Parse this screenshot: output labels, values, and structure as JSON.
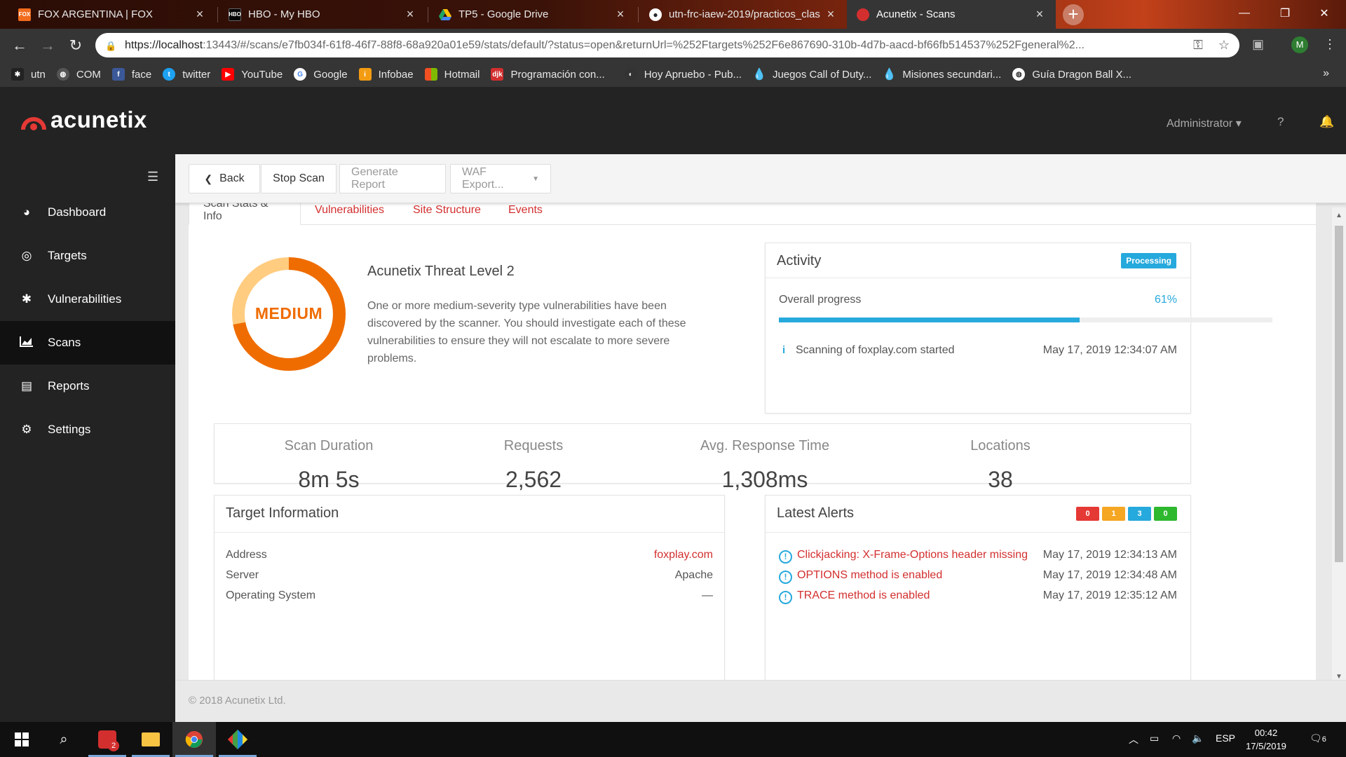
{
  "browser": {
    "tabs": [
      {
        "title": "FOX ARGENTINA | FOX",
        "favicon": "fox-icon",
        "color": "#f26b1d",
        "active": false
      },
      {
        "title": "HBO - My HBO",
        "favicon": "hbo-icon",
        "color": "#000000",
        "active": false
      },
      {
        "title": "TP5 - Google Drive",
        "favicon": "google-drive-icon",
        "color": "#1fa463",
        "active": false
      },
      {
        "title": "utn-frc-iaew-2019/practicos_clas",
        "favicon": "github-icon",
        "color": "#24292e",
        "active": false
      },
      {
        "title": "Acunetix - Scans",
        "favicon": "acunetix-icon",
        "color": "#d32f2f",
        "active": true
      }
    ],
    "url": {
      "host": "https://localhost",
      "rest": ":13443/#/scans/e7fb034f-61f8-46f7-88f8-68a920a01e59/stats/default/?status=open&returnUrl=%252Ftargets%252F6e867690-310b-4d7b-aacd-bf66fb514537%252Fgeneral%2..."
    },
    "profile_initial": "M",
    "bookmarks": [
      {
        "label": "utn",
        "icon": "utn-icon",
        "color": "#222222"
      },
      {
        "label": "COM",
        "icon": "globe-icon",
        "color": "#555555"
      },
      {
        "label": "face",
        "icon": "facebook-icon",
        "color": "#3b5998"
      },
      {
        "label": "twitter",
        "icon": "twitter-icon",
        "color": "#1da1f2"
      },
      {
        "label": "YouTube",
        "icon": "youtube-icon",
        "color": "#ff0000"
      },
      {
        "label": "Google",
        "icon": "google-icon",
        "color": "#4285f4"
      },
      {
        "label": "Infobae",
        "icon": "infobae-icon",
        "color": "#f39c12"
      },
      {
        "label": "Hotmail",
        "icon": "windows-icon",
        "color": "#f25022"
      },
      {
        "label": "Programación con...",
        "icon": "djk-icon",
        "color": "#d32f2f"
      },
      {
        "label": "Hoy Apruebo - Pub...",
        "icon": "site-icon",
        "color": "#444444"
      },
      {
        "label": "Juegos Call of Duty...",
        "icon": "drop-icon",
        "color": "#1e88e5"
      },
      {
        "label": "Misiones secundari...",
        "icon": "drop-icon",
        "color": "#1e88e5"
      },
      {
        "label": "Guía Dragon Ball X...",
        "icon": "globe-icon",
        "color": "#555555"
      }
    ]
  },
  "app": {
    "brand": "acunetix",
    "user": "Administrator",
    "nav": [
      {
        "label": "Dashboard",
        "icon": "dashboard-icon",
        "active": false
      },
      {
        "label": "Targets",
        "icon": "target-icon",
        "active": false
      },
      {
        "label": "Vulnerabilities",
        "icon": "bug-icon",
        "active": false
      },
      {
        "label": "Scans",
        "icon": "chart-icon",
        "active": true
      },
      {
        "label": "Reports",
        "icon": "report-icon",
        "active": false
      },
      {
        "label": "Settings",
        "icon": "gear-icon",
        "active": false
      }
    ],
    "actions": {
      "back": "Back",
      "stop_scan": "Stop Scan",
      "generate_report": "Generate Report",
      "waf_export": "WAF Export..."
    },
    "tabs": [
      "Scan Stats & Info",
      "Vulnerabilities",
      "Site Structure",
      "Events"
    ],
    "threat": {
      "title": "Acunetix Threat Level 2",
      "level_label": "MEDIUM",
      "level": 2,
      "description": "One or more medium-severity type vulnerabilities have been discovered by the scanner. You should investigate each of these vulnerabilities to ensure they will not escalate to more severe problems."
    },
    "activity": {
      "title": "Activity",
      "status": "Processing",
      "progress_label": "Overall progress",
      "progress_text": "61%",
      "progress": 61,
      "events": [
        {
          "text": "Scanning of foxplay.com started",
          "time": "May 17, 2019 12:34:07 AM"
        }
      ]
    },
    "stats": [
      {
        "label": "Scan Duration",
        "value": "8m 5s"
      },
      {
        "label": "Requests",
        "value": "2,562"
      },
      {
        "label": "Avg. Response Time",
        "value": "1,308ms"
      },
      {
        "label": "Locations",
        "value": "38"
      }
    ],
    "target_info": {
      "title": "Target Information",
      "rows": [
        {
          "label": "Address",
          "value": "foxplay.com"
        },
        {
          "label": "Server",
          "value": "Apache"
        },
        {
          "label": "Operating System",
          "value": "—"
        }
      ]
    },
    "latest_alerts": {
      "title": "Latest Alerts",
      "counts": [
        {
          "value": "0",
          "color": "#e53935"
        },
        {
          "value": "1",
          "color": "#f5a623"
        },
        {
          "value": "3",
          "color": "#26a9dc"
        },
        {
          "value": "0",
          "color": "#2eb82e"
        }
      ],
      "items": [
        {
          "text": "Clickjacking: X-Frame-Options header missing",
          "time": "May 17, 2019 12:34:13 AM"
        },
        {
          "text": "OPTIONS method is enabled",
          "time": "May 17, 2019 12:34:48 AM"
        },
        {
          "text": "TRACE method is enabled",
          "time": "May 17, 2019 12:35:12 AM"
        }
      ]
    },
    "footer": "© 2018 Acunetix Ltd."
  },
  "taskbar": {
    "badge_count": "2",
    "language": "ESP",
    "time": "00:42",
    "date": "17/5/2019",
    "notifications": "6"
  }
}
